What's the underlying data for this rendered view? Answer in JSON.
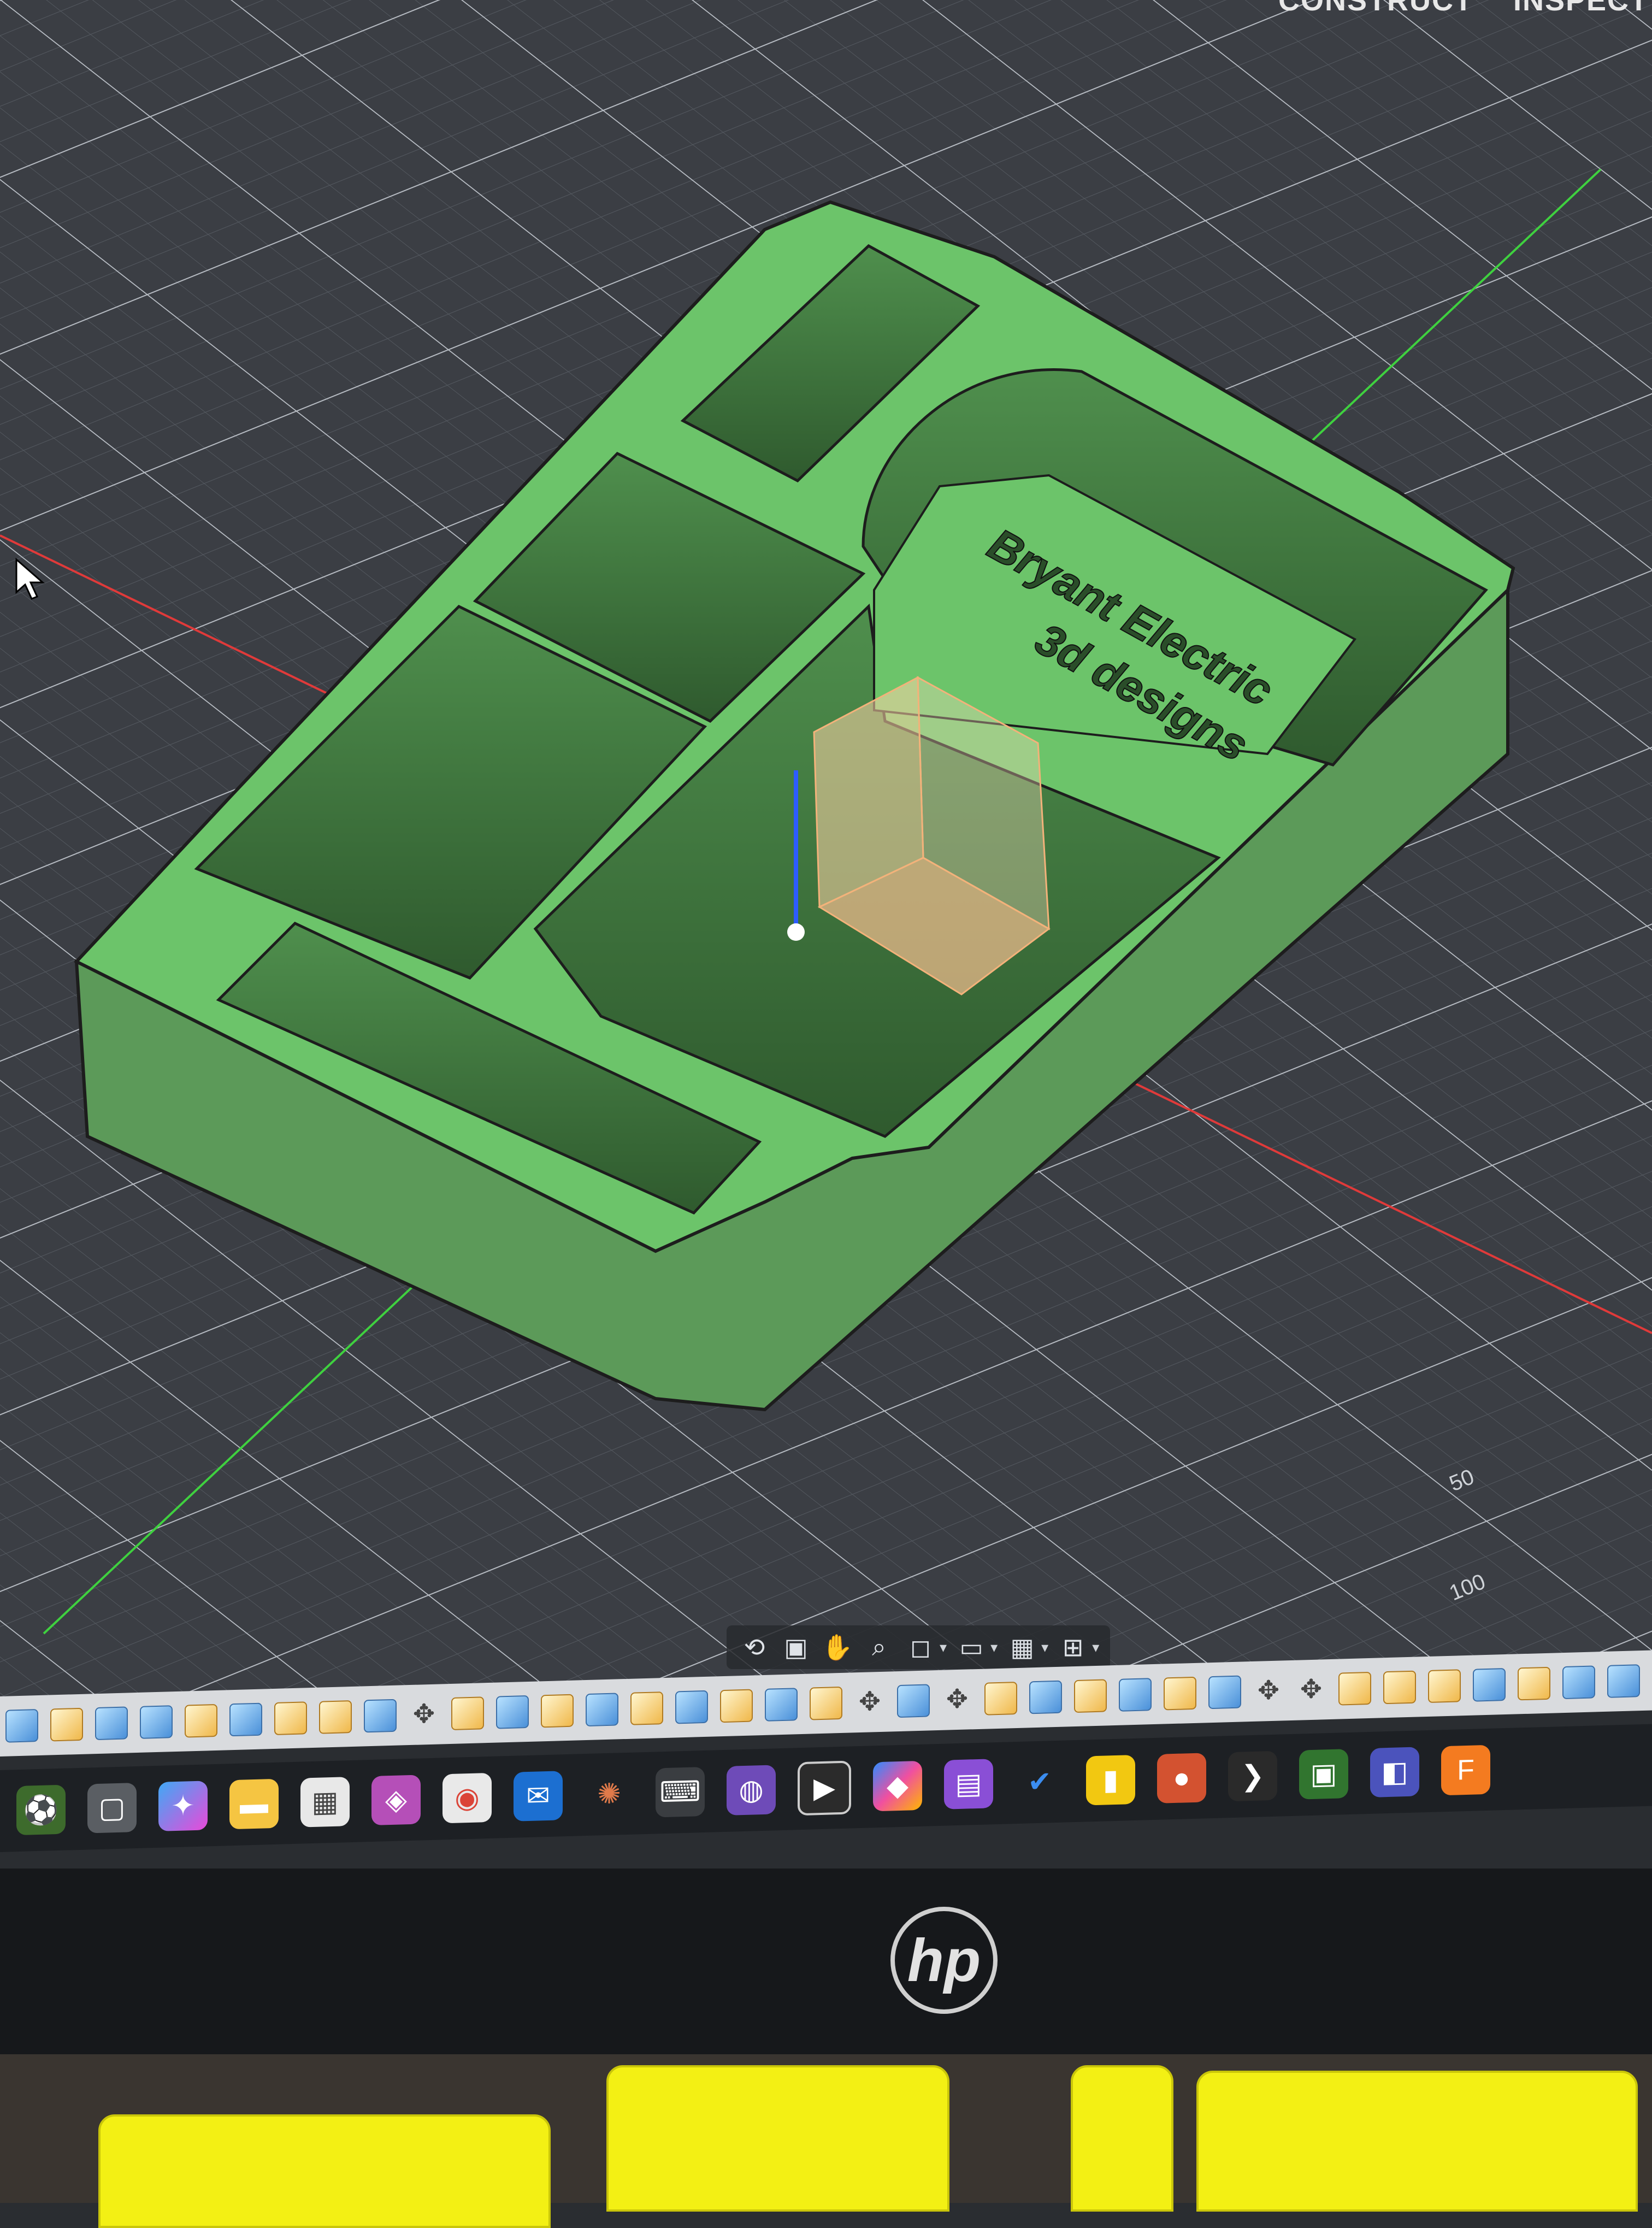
{
  "menu": {
    "tabs": [
      {
        "label": "CONSTRUCT"
      },
      {
        "label": "INSPECT"
      }
    ]
  },
  "viewport": {
    "grid_scale_labels": [
      "50",
      "100"
    ],
    "model_text_line1": "Bryant Electric",
    "model_text_line2": "3d designs",
    "colors": {
      "background": "#3b3e44",
      "model": "#6cc46a",
      "x_axis": "#e03a3a",
      "y_axis": "#3fd13f",
      "z_axis": "#2d5cff",
      "selection_box": "#ffd6a8"
    }
  },
  "nav_toolbar": {
    "icons": [
      "orbit-icon",
      "look-at-icon",
      "pan-icon",
      "zoom-icon",
      "fit-icon",
      "display-settings-icon",
      "grid-settings-icon",
      "viewports-icon"
    ]
  },
  "design_toolbar": {
    "icon_count_hint": "mesh tool icons"
  },
  "taskbar": {
    "apps": [
      "weather-widget",
      "task-view",
      "copilot",
      "file-explorer",
      "microsoft-store",
      "power-apps",
      "chrome",
      "outlook",
      "claude",
      "terminal",
      "github",
      "media-player",
      "microsoft-365",
      "clipchamp",
      "todo",
      "power-bi",
      "powerpoint",
      "powershell",
      "project",
      "teams",
      "fusion"
    ]
  },
  "monitor": {
    "brand": "hp"
  }
}
